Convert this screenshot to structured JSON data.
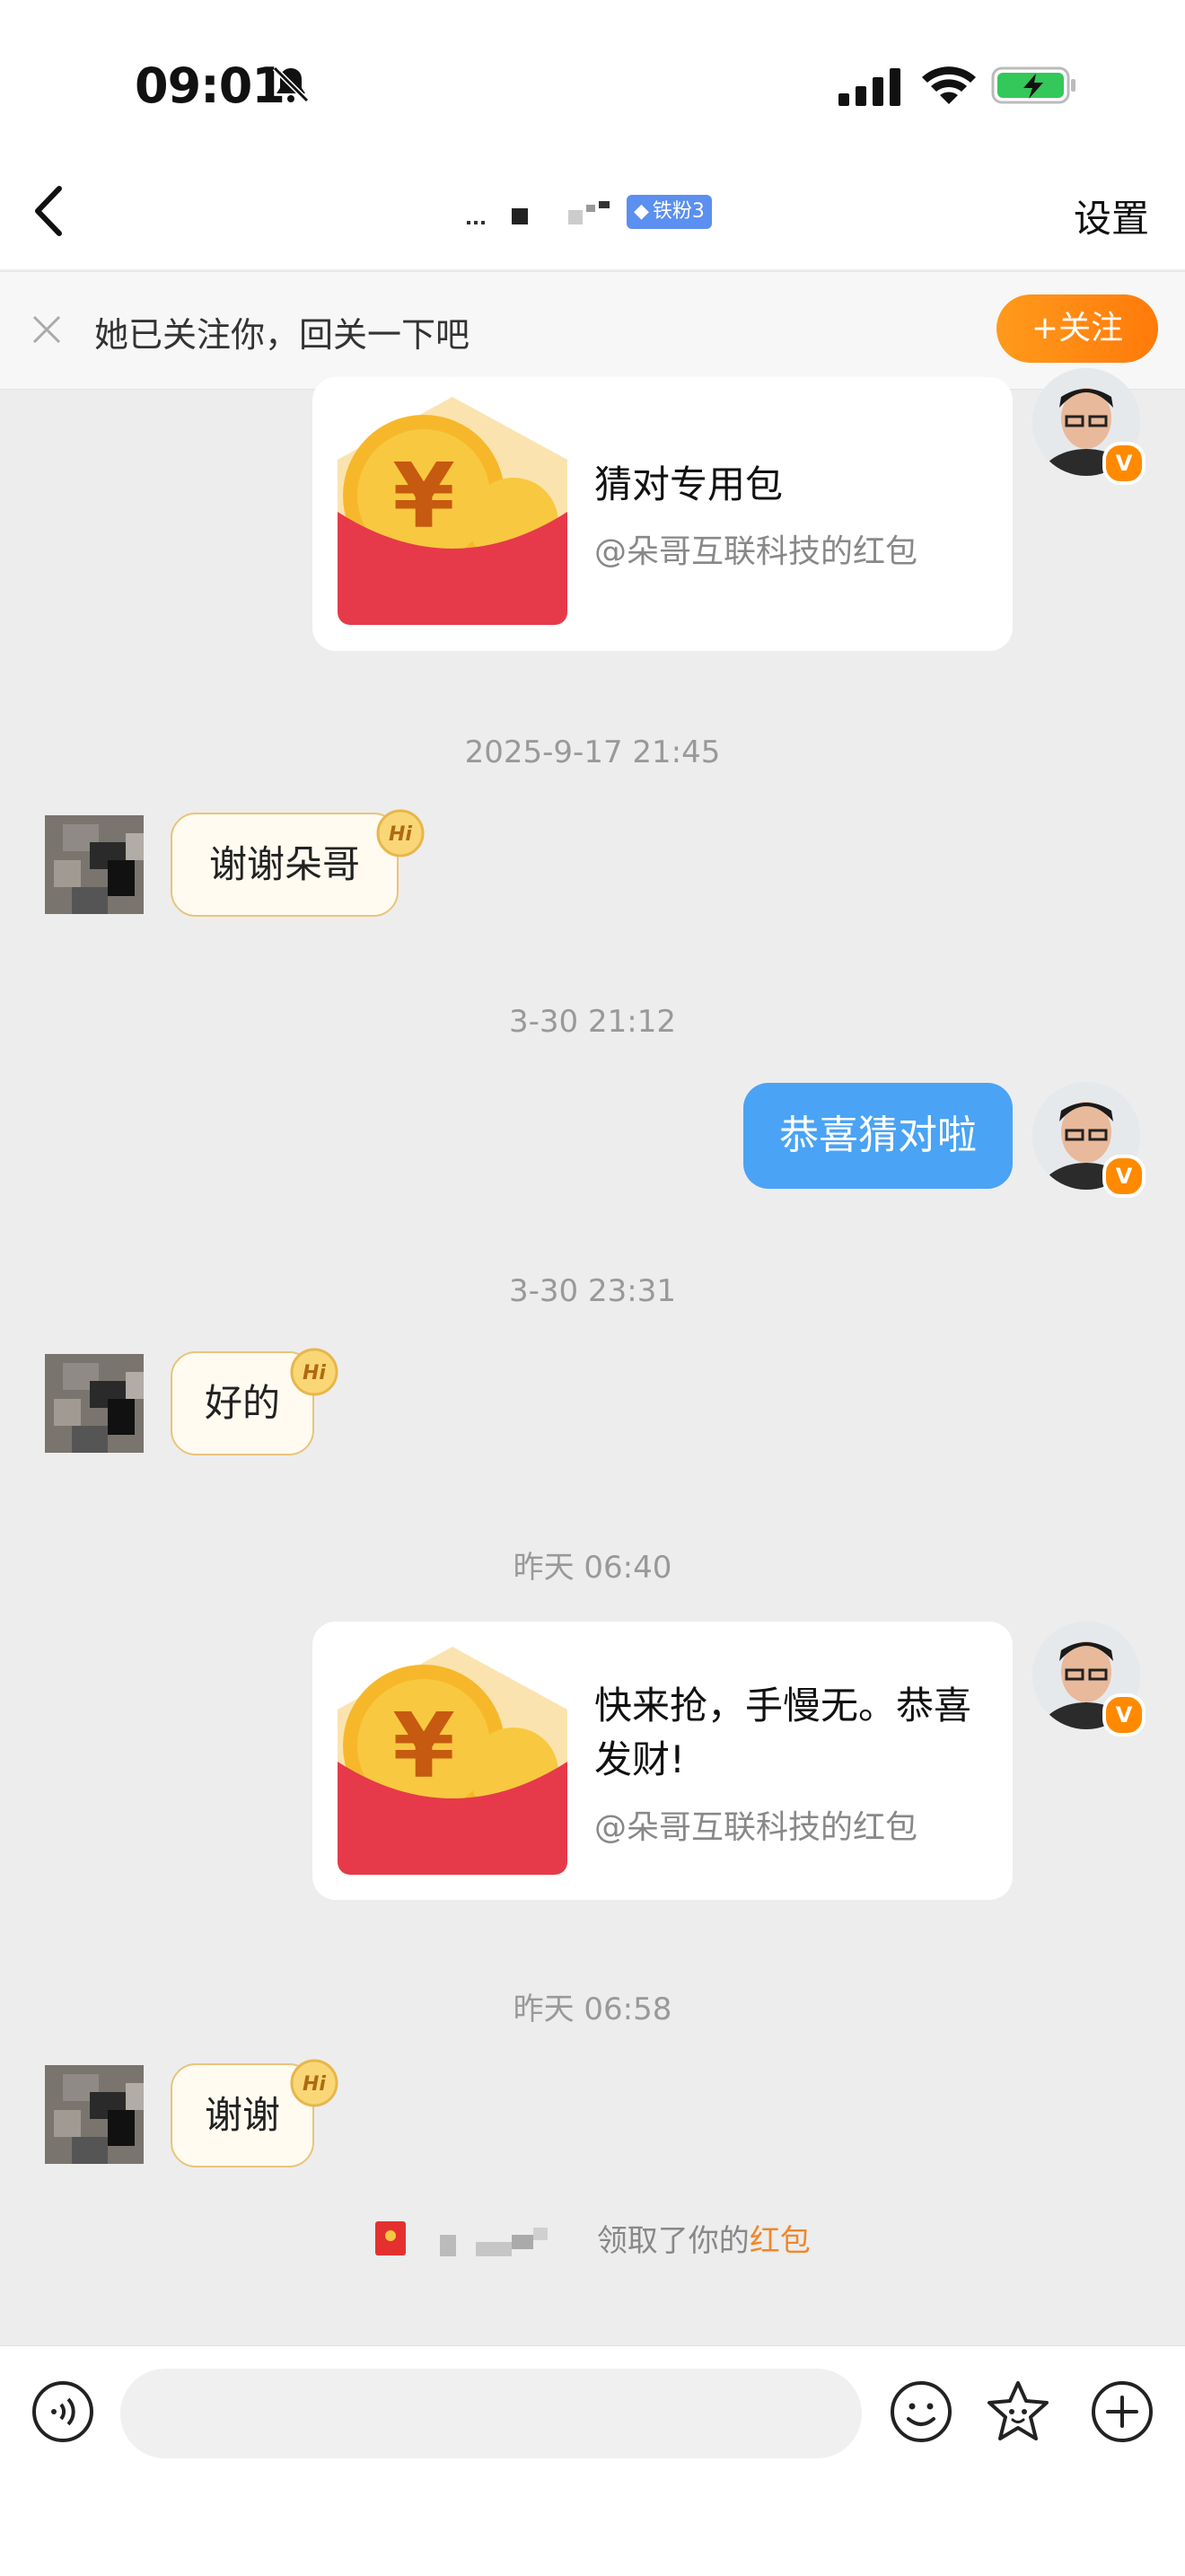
{
  "status_bar": {
    "time": "09:01"
  },
  "nav": {
    "title_masked": "",
    "fan_badge": "铁粉3",
    "settings_label": "设置"
  },
  "follow_banner": {
    "text": "她已关注你，回关一下吧",
    "button_label": "+关注"
  },
  "messages": [
    {
      "type": "redpacket",
      "from": "me",
      "title": "猜对专用包",
      "subtitle": "@朵哥互联科技的红包"
    },
    {
      "type": "timestamp",
      "text": "2025-9-17 21:45"
    },
    {
      "type": "text",
      "from": "other",
      "text": "谢谢朵哥"
    },
    {
      "type": "timestamp",
      "text": "3-30 21:12"
    },
    {
      "type": "text",
      "from": "me",
      "text": "恭喜猜对啦"
    },
    {
      "type": "timestamp",
      "text": "3-30 23:31"
    },
    {
      "type": "text",
      "from": "other",
      "text": "好的"
    },
    {
      "type": "timestamp",
      "text": "昨天 06:40"
    },
    {
      "type": "redpacket",
      "from": "me",
      "title": "快来抢，手慢无。恭喜发财!",
      "subtitle": "@朵哥互联科技的红包"
    },
    {
      "type": "timestamp",
      "text": "昨天 06:58"
    },
    {
      "type": "text",
      "from": "other",
      "text": "谢谢"
    }
  ],
  "received_notice": {
    "prefix": "领取了你的",
    "link": "红包"
  },
  "hi_badge": "Hi",
  "v_badge": "V",
  "colors": {
    "accent_blue": "#4aa3f5",
    "follow_orange": "#ff8a10",
    "redpacket_red": "#e63a4a"
  },
  "icons": [
    "bell-muted-icon",
    "signal-icon",
    "wifi-icon",
    "battery-charging-icon",
    "back-chevron-icon",
    "close-icon",
    "voice-icon",
    "emoji-icon",
    "sticker-icon",
    "plus-icon"
  ]
}
